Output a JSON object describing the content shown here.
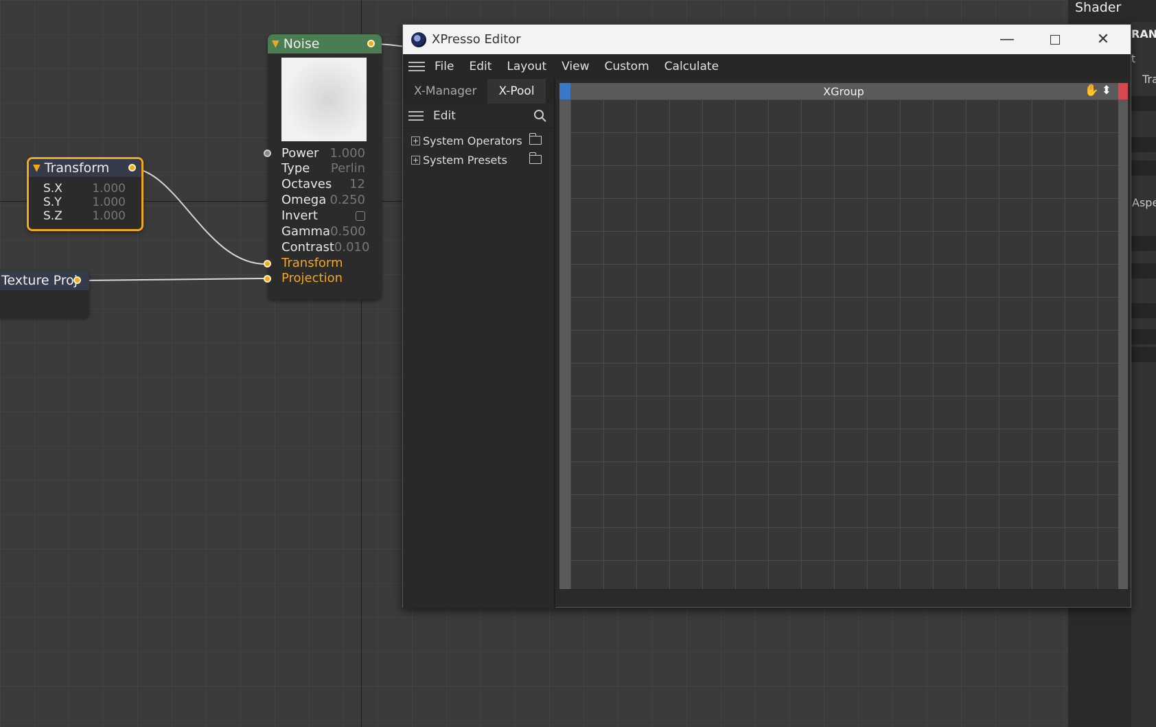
{
  "right_panel": {
    "title": "Shader",
    "fragments": [
      "RANS",
      "t",
      "Tra",
      "Aspe"
    ]
  },
  "nodes": {
    "transform": {
      "title": "Transform",
      "rows": [
        {
          "label": "S.X",
          "value": "1.000"
        },
        {
          "label": "S.Y",
          "value": "1.000"
        },
        {
          "label": "S.Z",
          "value": "1.000"
        }
      ]
    },
    "texture": {
      "title": "Texture Proj"
    },
    "noise": {
      "title": "Noise",
      "params": [
        {
          "label": "Power",
          "value": "1.000"
        },
        {
          "label": "Type",
          "value": "Perlin"
        },
        {
          "label": "Octaves",
          "value": "12"
        },
        {
          "label": "Omega",
          "value": "0.250"
        },
        {
          "label": "Invert",
          "value": ""
        },
        {
          "label": "Gamma",
          "value": "0.500"
        },
        {
          "label": "Contrast",
          "value": "0.010"
        }
      ],
      "inputs": [
        "Transform",
        "Projection"
      ]
    }
  },
  "xpresso": {
    "title": "XPresso Editor",
    "menu": [
      "File",
      "Edit",
      "Layout",
      "View",
      "Custom",
      "Calculate"
    ],
    "tabs": [
      "X-Manager",
      "X-Pool"
    ],
    "active_tab": "X-Pool",
    "subbar_label": "Edit",
    "tree": [
      "System Operators",
      "System Presets"
    ],
    "xgroup_title": "XGroup"
  },
  "colors": {
    "port": "#f2a81d",
    "noise_header": "#4a7d52",
    "transform_border": "#f2a81d",
    "xgroup_blue": "#3a78c8",
    "xgroup_red": "#d9484e"
  }
}
